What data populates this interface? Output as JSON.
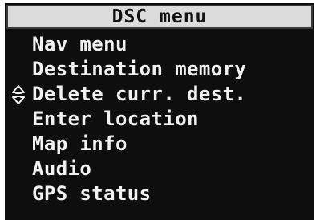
{
  "header": {
    "title": "DSC menu"
  },
  "menu": {
    "items": [
      {
        "label": "Nav menu",
        "selected": false
      },
      {
        "label": "Destination memory",
        "selected": false
      },
      {
        "label": "Delete curr. dest.",
        "selected": true
      },
      {
        "label": "Enter location",
        "selected": false
      },
      {
        "label": "Map info",
        "selected": false
      },
      {
        "label": "Audio",
        "selected": false
      },
      {
        "label": "GPS status",
        "selected": false
      }
    ]
  },
  "icons": {
    "selector": "up-down-arrows-icon"
  },
  "colors": {
    "background": "#0e0e0e",
    "text": "#f2f2f2",
    "title_bar": "#dcdcdc",
    "title_text": "#111111"
  }
}
